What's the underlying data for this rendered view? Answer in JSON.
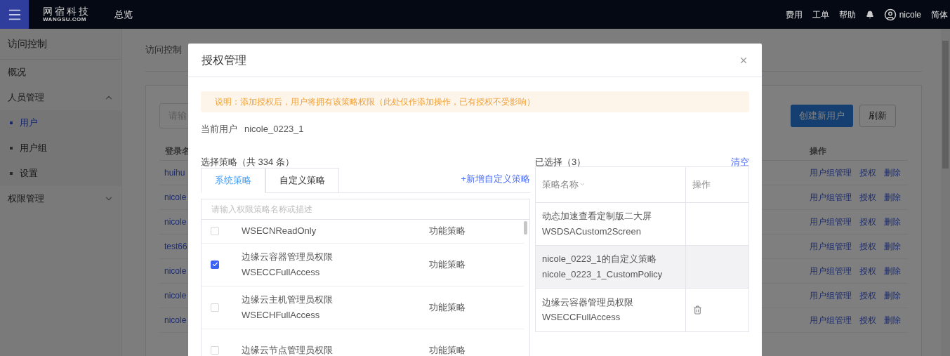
{
  "top_bar": {
    "logo": {
      "name": "网宿科技",
      "sub": "WANGSU.COM"
    },
    "nav": [
      "总览"
    ],
    "links": [
      "费用",
      "工单",
      "帮助"
    ],
    "user": "nicole",
    "language": "简体"
  },
  "sidebar": {
    "title": "访问控制",
    "items": [
      {
        "label": "概况",
        "kind": "link"
      },
      {
        "label": "人员管理",
        "kind": "group",
        "expanded": true,
        "children": [
          {
            "label": "用户",
            "selected": true
          },
          {
            "label": "用户组",
            "selected": false
          },
          {
            "label": "设置",
            "selected": false
          }
        ]
      },
      {
        "label": "权限管理",
        "kind": "group",
        "expanded": false
      }
    ]
  },
  "page": {
    "breadcrumb": "访问控制",
    "search": {
      "placeholder": "请输"
    },
    "buttons": [
      {
        "label": "创建新用户",
        "kind": "primary"
      },
      {
        "label": "刷新",
        "kind": "default"
      }
    ],
    "table": {
      "columns": [
        "登录名",
        "操作"
      ],
      "rows": [
        {
          "login": "huihu",
          "actions": [
            "用户组管理",
            "授权",
            "删除"
          ]
        },
        {
          "login": "nicole",
          "actions": [
            "用户组管理",
            "授权",
            "删除"
          ]
        },
        {
          "login": "nicole",
          "actions": [
            "用户组管理",
            "授权",
            "删除"
          ]
        },
        {
          "login": "test66",
          "actions": [
            "用户组管理",
            "授权",
            "删除"
          ]
        },
        {
          "login": "nicole",
          "actions": [
            "用户组管理",
            "授权",
            "删除"
          ]
        },
        {
          "login": "nicole",
          "actions": [
            "用户组管理",
            "授权",
            "删除"
          ]
        },
        {
          "login": "nicole",
          "actions": [
            "用户组管理",
            "授权",
            "删除"
          ]
        }
      ]
    }
  },
  "modal": {
    "title": "授权管理",
    "notice": "说明：添加授权后，用户将拥有该策略权限（此处仅作添加操作，已有授权不受影响）",
    "current_user_label": "当前用户",
    "current_user": "nicole_0223_1",
    "left": {
      "title": "选择策略（共 334 条）",
      "tabs": [
        {
          "label": "系统策略",
          "selected": true
        },
        {
          "label": "自定义策略",
          "selected": false
        }
      ],
      "add_link": "+新增自定义策略",
      "search": {
        "placeholder": "请输入权限策略名称或描述"
      },
      "policies": [
        {
          "code": "WSECNReadOnly",
          "type": "功能策略",
          "checked": false
        },
        {
          "title": "边缘云容器管理员权限",
          "code": "WSECCFullAccess",
          "type": "功能策略",
          "checked": true
        },
        {
          "title": "边缘云主机管理员权限",
          "code": "WSECHFullAccess",
          "type": "功能策略",
          "checked": false
        },
        {
          "title": "边缘云节点管理员权限",
          "type": "功能策略",
          "checked": false
        }
      ]
    },
    "right": {
      "title": "已选择（3）",
      "clear": "清空",
      "columns": [
        "策略名称",
        "操作"
      ],
      "rows": [
        {
          "title": "动态加速查看定制版二大屏",
          "code": "WSDSACustom2Screen",
          "highlighted": false,
          "show_delete": false
        },
        {
          "title": "nicole_0223_1的自定义策略",
          "code": "nicole_0223_1_CustomPolicy",
          "highlighted": true,
          "show_delete": false
        },
        {
          "title": "边缘云容器管理员权限",
          "code": "WSECCFullAccess",
          "highlighted": false,
          "show_delete": true
        }
      ]
    }
  }
}
